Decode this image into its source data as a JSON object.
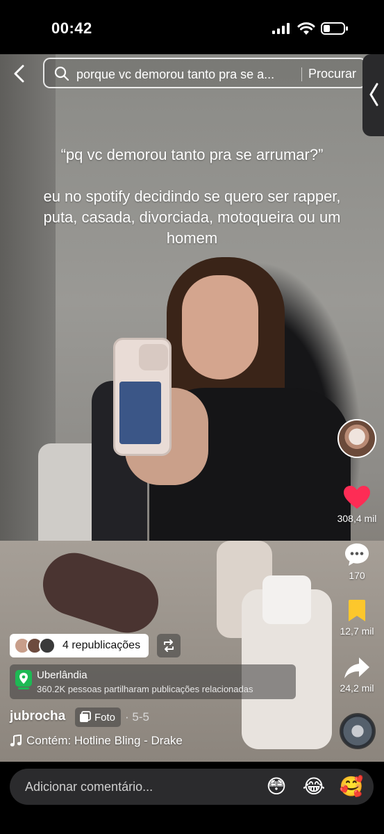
{
  "status_bar": {
    "time": "00:42"
  },
  "search": {
    "query": "porque vc demorou tanto pra se a...",
    "button_label": "Procurar"
  },
  "caption": {
    "line1": "“pq vc demorou tanto pra se arrumar?”",
    "line2": "eu no spotify decidindo se quero ser rapper, puta, casada, divorciada, motoqueira ou um homem"
  },
  "actions": {
    "likes": "308,4 mil",
    "comments": "170",
    "saves": "12,7 mil",
    "shares": "24,2 mil",
    "like_color": "#fe2c55",
    "save_color": "#fcc72c"
  },
  "repost": {
    "label": "4 republicações"
  },
  "location": {
    "name": "Uberlândia",
    "subtitle": "360.2K pessoas partilharam publicações relacionadas"
  },
  "post": {
    "author": "jubrocha",
    "type_badge": "Foto",
    "date": "· 5-5",
    "music": "Contém: Hotline Bling - Drake"
  },
  "comment_bar": {
    "placeholder": "Adicionar comentário...",
    "emojis": [
      "😳",
      "😂",
      "🥰"
    ]
  }
}
